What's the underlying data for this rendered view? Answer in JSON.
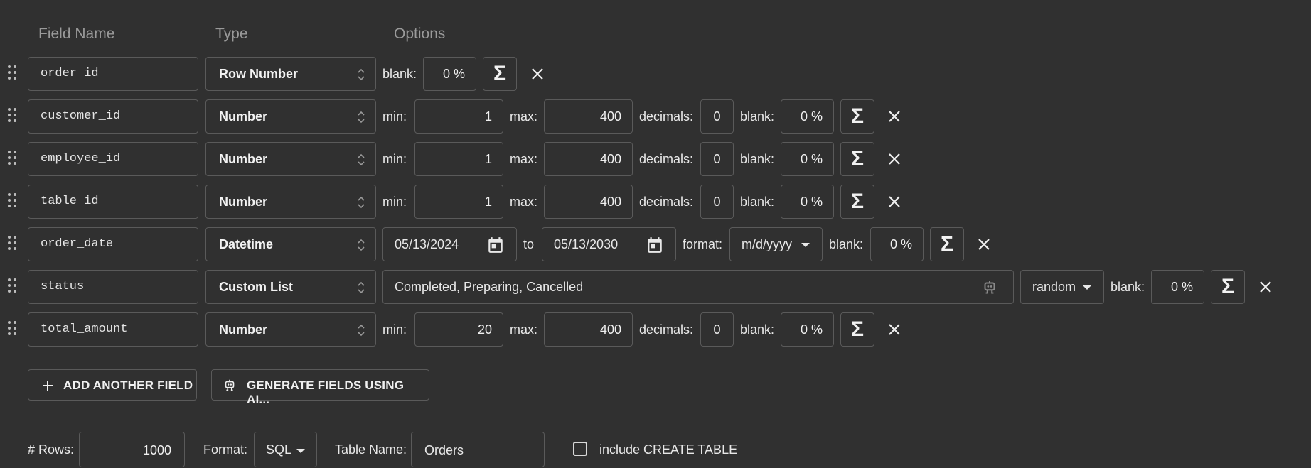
{
  "headers": {
    "field_name": "Field Name",
    "type": "Type",
    "options": "Options"
  },
  "labels": {
    "blank": "blank:",
    "min": "min:",
    "max": "max:",
    "decimals": "decimals:",
    "to": "to",
    "format": "format:"
  },
  "rows": [
    {
      "name": "order_id",
      "type": "Row Number",
      "blank": "0 %"
    },
    {
      "name": "customer_id",
      "type": "Number",
      "min": "1",
      "max": "400",
      "decimals": "0",
      "blank": "0 %"
    },
    {
      "name": "employee_id",
      "type": "Number",
      "min": "1",
      "max": "400",
      "decimals": "0",
      "blank": "0 %"
    },
    {
      "name": "table_id",
      "type": "Number",
      "min": "1",
      "max": "400",
      "decimals": "0",
      "blank": "0 %"
    },
    {
      "name": "order_date",
      "type": "Datetime",
      "from": "05/13/2024",
      "to": "05/13/2030",
      "format": "m/d/yyyy",
      "blank": "0 %"
    },
    {
      "name": "status",
      "type": "Custom List",
      "values": "Completed, Preparing, Cancelled",
      "mode": "random",
      "blank": "0 %"
    },
    {
      "name": "total_amount",
      "type": "Number",
      "min": "20",
      "max": "400",
      "decimals": "0",
      "blank": "0 %"
    }
  ],
  "sigma": "Σ",
  "buttons": {
    "add_field": "ADD ANOTHER FIELD",
    "generate_ai": "GENERATE FIELDS USING AI..."
  },
  "footer": {
    "rows_label": "# Rows:",
    "rows_value": "1000",
    "format_label": "Format:",
    "format_value": "SQL",
    "table_name_label": "Table Name:",
    "table_name_value": "Orders",
    "include_create_label": "include CREATE TABLE",
    "include_create_checked": false
  },
  "icons": {
    "drag": "drag-handle-icon",
    "updown": "unfold-icon",
    "sigma": "sigma-icon",
    "close": "close-icon",
    "calendar": "calendar-icon",
    "robot": "robot-icon",
    "plus": "plus-icon"
  },
  "colors": {
    "background": "#303030",
    "border": "#5a5a5a",
    "text": "#e8e8e8",
    "muted": "#9a9a9a"
  }
}
